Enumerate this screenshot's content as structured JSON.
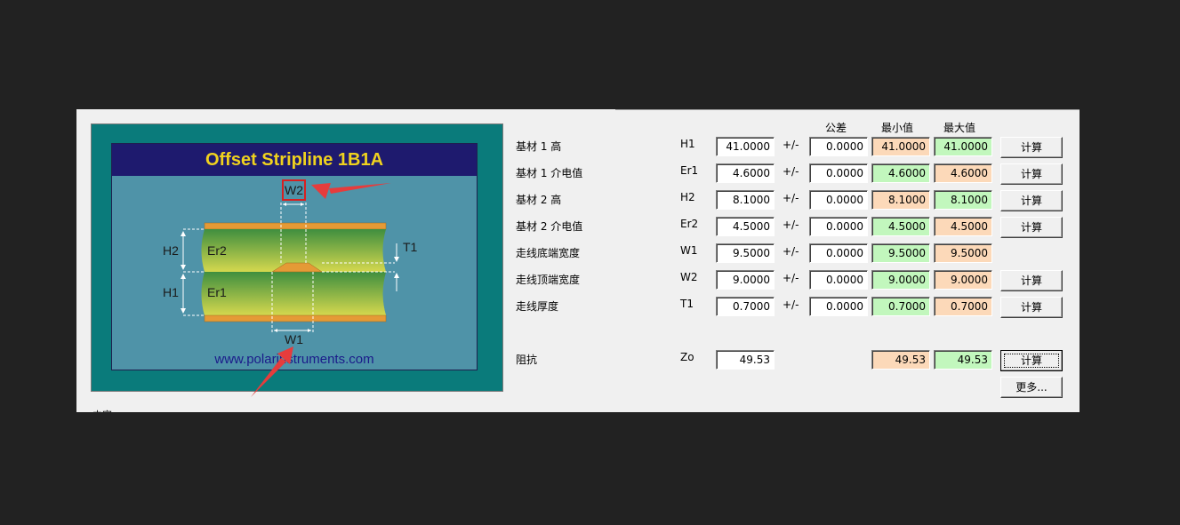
{
  "diagram": {
    "title": "Offset Stripline 1B1A",
    "url": "www.polarinstruments.com",
    "labels": {
      "w2": "W2",
      "w1": "W1",
      "h2": "H2",
      "h1": "H1",
      "er2": "Er2",
      "er1": "Er1",
      "t1": "T1"
    },
    "colors": {
      "frame": "#0a7b7b",
      "canvas": "#4f93a8",
      "title_bg": "#1e1a6e",
      "title_text": "#f0d21e",
      "arrow": "#e63c3c"
    }
  },
  "status_partial_label": "中容",
  "columns": {
    "tolerance": "公差",
    "min": "最小值",
    "max": "最大值"
  },
  "plus_minus": "+/-",
  "rows": [
    {
      "label": "基材 1 高",
      "symbol": "H1",
      "value": "41.0000",
      "tolerance": "0.0000",
      "min": "41.0000",
      "max": "41.0000",
      "button": "计算"
    },
    {
      "label": "基材 1 介电值",
      "symbol": "Er1",
      "value": "4.6000",
      "tolerance": "0.0000",
      "min": "4.6000",
      "max": "4.6000",
      "button": "计算"
    },
    {
      "label": "基材 2 高",
      "symbol": "H2",
      "value": "8.1000",
      "tolerance": "0.0000",
      "min": "8.1000",
      "max": "8.1000",
      "button": "计算"
    },
    {
      "label": "基材 2 介电值",
      "symbol": "Er2",
      "value": "4.5000",
      "tolerance": "0.0000",
      "min": "4.5000",
      "max": "4.5000",
      "button": "计算"
    },
    {
      "label": "走线底端宽度",
      "symbol": "W1",
      "value": "9.5000",
      "tolerance": "0.0000",
      "min": "9.5000",
      "max": "9.5000",
      "button": ""
    },
    {
      "label": "走线顶端宽度",
      "symbol": "W2",
      "value": "9.0000",
      "tolerance": "0.0000",
      "min": "9.0000",
      "max": "9.0000",
      "button": "计算"
    },
    {
      "label": "走线厚度",
      "symbol": "T1",
      "value": "0.7000",
      "tolerance": "0.0000",
      "min": "0.7000",
      "max": "0.7000",
      "button": "计算"
    }
  ],
  "impedance": {
    "label": "阻抗",
    "symbol": "Zo",
    "value": "49.53",
    "min": "49.53",
    "max": "49.53",
    "button": "计算"
  },
  "more_button": "更多..."
}
